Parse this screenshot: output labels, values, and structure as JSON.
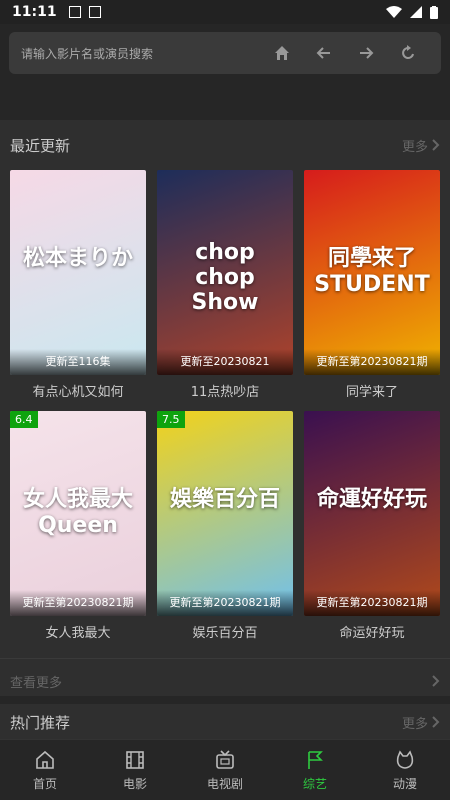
{
  "status": {
    "time": "11:11"
  },
  "search": {
    "placeholder": "请输入影片名或演员搜索"
  },
  "recent": {
    "title": "最近更新",
    "more_label": "更多",
    "see_more": "查看更多",
    "items": [
      {
        "name": "有点心机又如何",
        "caption": "更新至116集",
        "poster_text": "松本まりか",
        "score": "",
        "bg1": "#f6d9e6",
        "bg2": "#c9e8f0"
      },
      {
        "name": "11点热吵店",
        "caption": "更新至20230821",
        "poster_text": "chop chop Show",
        "score": "",
        "bg1": "#1d2d5a",
        "bg2": "#b0432a"
      },
      {
        "name": "同学来了",
        "caption": "更新至第20230821期",
        "poster_text": "同學来了 STUDENT",
        "score": "",
        "bg1": "#d61c1c",
        "bg2": "#f0b400"
      },
      {
        "name": "女人我最大",
        "caption": "更新至第20230821期",
        "poster_text": "女人我最大 Queen",
        "score": "6.4",
        "bg1": "#f5e3ea",
        "bg2": "#ead0dc"
      },
      {
        "name": "娱乐百分百",
        "caption": "更新至第20230821期",
        "poster_text": "娛樂百分百",
        "score": "7.5",
        "bg1": "#f2d21a",
        "bg2": "#6fc0ef"
      },
      {
        "name": "命运好好玩",
        "caption": "更新至第20230821期",
        "poster_text": "命運好好玩",
        "score": "",
        "bg1": "#3a1050",
        "bg2": "#b24a1a"
      }
    ]
  },
  "hot": {
    "title": "热门推荐",
    "more_label": "更多"
  },
  "tabs": [
    {
      "label": "首页",
      "icon": "home-icon"
    },
    {
      "label": "电影",
      "icon": "film-icon"
    },
    {
      "label": "电视剧",
      "icon": "tv-icon"
    },
    {
      "label": "综艺",
      "icon": "flag-icon"
    },
    {
      "label": "动漫",
      "icon": "anime-icon"
    }
  ],
  "colors": {
    "accent": "#2ecc40",
    "score_badge": "#0ea30e"
  }
}
